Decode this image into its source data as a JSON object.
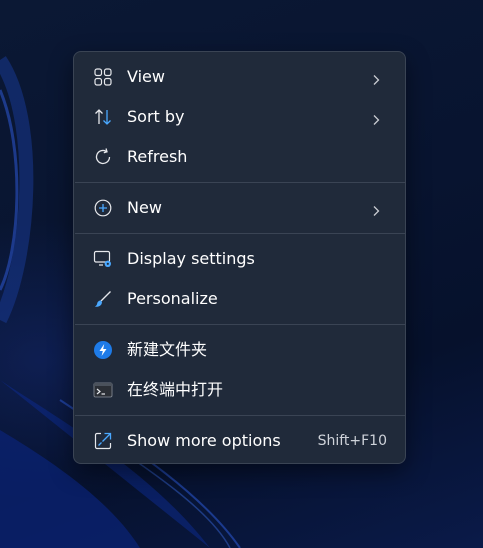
{
  "context_menu": {
    "items": [
      {
        "label": "View",
        "icon": "grid-icon",
        "has_submenu": true
      },
      {
        "label": "Sort by",
        "icon": "sort-arrows-icon",
        "has_submenu": true
      },
      {
        "label": "Refresh",
        "icon": "refresh-icon",
        "has_submenu": false
      },
      {
        "label": "New",
        "icon": "plus-circle-icon",
        "has_submenu": true
      },
      {
        "label": "Display settings",
        "icon": "display-settings-icon",
        "has_submenu": false
      },
      {
        "label": "Personalize",
        "icon": "brush-icon",
        "has_submenu": false
      },
      {
        "label": "新建文件夹",
        "icon": "app-badge-icon",
        "has_submenu": false
      },
      {
        "label": "在终端中打开",
        "icon": "terminal-icon",
        "has_submenu": false
      },
      {
        "label": "Show more options",
        "icon": "show-more-options-icon",
        "shortcut": "Shift+F10",
        "has_submenu": false
      }
    ]
  },
  "colors": {
    "menu_background": "#202a3a",
    "accent_blue": "#4aa8ff",
    "text": "#ffffff",
    "shortcut_text": "#cfd3da"
  }
}
